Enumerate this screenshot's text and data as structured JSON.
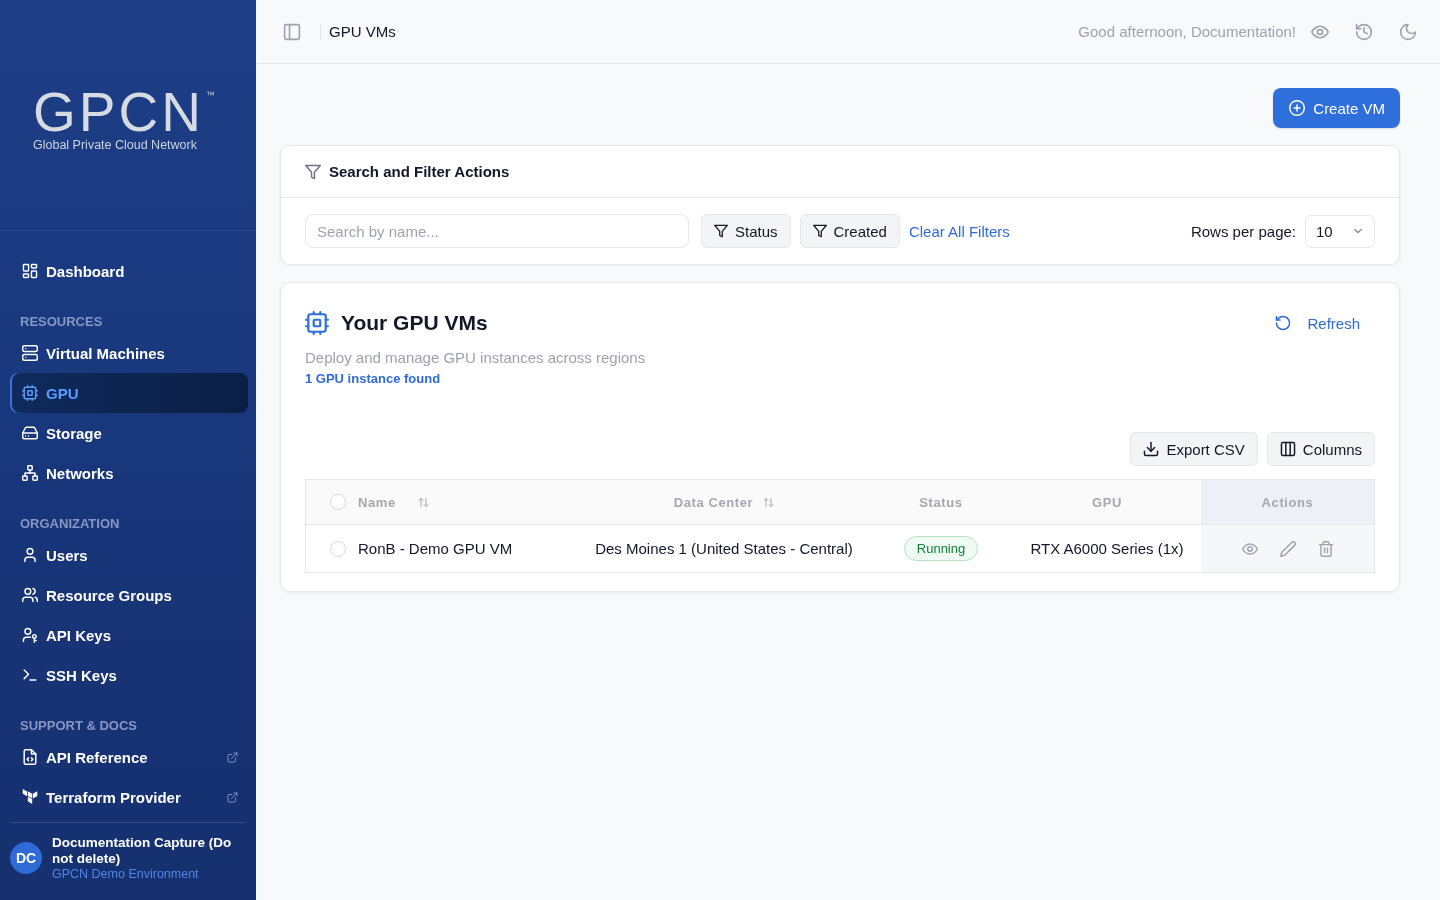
{
  "sidebar": {
    "logo": {
      "wordmark": "GPCN",
      "trademark": "™",
      "tagline": "Global Private Cloud Network"
    },
    "sections": [
      {
        "items": [
          {
            "label": "Dashboard",
            "selected": false
          }
        ]
      },
      {
        "heading": "RESOURCES",
        "items": [
          {
            "label": "Virtual Machines",
            "selected": false
          },
          {
            "label": "GPU",
            "selected": true
          },
          {
            "label": "Storage",
            "selected": false
          },
          {
            "label": "Networks",
            "selected": false
          }
        ]
      },
      {
        "heading": "ORGANIZATION",
        "items": [
          {
            "label": "Users",
            "selected": false
          },
          {
            "label": "Resource Groups",
            "selected": false
          },
          {
            "label": "API Keys",
            "selected": false
          },
          {
            "label": "SSH Keys",
            "selected": false
          }
        ]
      },
      {
        "heading": "SUPPORT & DOCS",
        "items": [
          {
            "label": "API Reference",
            "selected": false,
            "external": true
          },
          {
            "label": "Terraform Provider",
            "selected": false,
            "external": true
          }
        ]
      }
    ],
    "user": {
      "initials": "DC",
      "name": "Documentation Capture (Do not delete)",
      "environment": "GPCN Demo Environment"
    }
  },
  "top_bar": {
    "title": "GPU VMs",
    "greeting": "Good afternoon, Documentation!"
  },
  "create_button": "Create VM",
  "filter_panel": {
    "title": "Search and Filter Actions",
    "search": {
      "placeholder": "Search by name..."
    },
    "filters": [
      "Status",
      "Created"
    ],
    "clear_link": "Clear All Filters",
    "rows_per_page": {
      "label": "Rows per page:",
      "value": "10"
    }
  },
  "vm_panel": {
    "title": "Your GPU VMs",
    "refresh": "Refresh",
    "subtitle": "Deploy and manage GPU instances across regions",
    "count": "1 GPU instance found",
    "toolbar": [
      "Export CSV",
      "Columns"
    ],
    "table": {
      "select_all_checked": false,
      "columns": [
        {
          "label": "Name",
          "sortable": true
        },
        {
          "label": "Data Center",
          "sortable": true
        },
        {
          "label": "Status",
          "sortable": false
        },
        {
          "label": "GPU",
          "sortable": false
        },
        {
          "label": "Actions",
          "sortable": false
        }
      ],
      "rows": [
        {
          "checked": false,
          "name": "RonB - Demo GPU VM",
          "data_center": "Des Moines 1 (United States - Central)",
          "status": {
            "label": "Running",
            "kind": "running"
          },
          "gpu": "RTX A6000 Series (1x)"
        }
      ]
    }
  }
}
